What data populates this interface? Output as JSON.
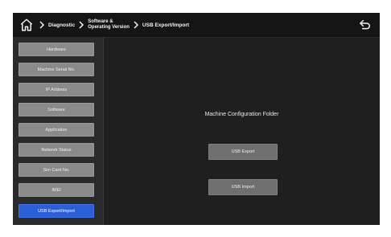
{
  "breadcrumb": {
    "home_icon": "home-icon",
    "items": [
      "Diagnostic",
      "Software &",
      "Operating Version",
      "USB Export/Import"
    ],
    "back_icon": "back-arrow-icon"
  },
  "sidebar": {
    "items": [
      {
        "label": "Hardware"
      },
      {
        "label": "Machine Serial No."
      },
      {
        "label": "IP Address"
      },
      {
        "label": "Software"
      },
      {
        "label": "Application"
      },
      {
        "label": "Network Status"
      },
      {
        "label": "Sim Card No."
      },
      {
        "label": "IMEI"
      },
      {
        "label": "USB Export/Import",
        "active": true
      }
    ]
  },
  "main": {
    "title": "Machine Configuration Folder",
    "export_label": "USB Export",
    "import_label": "USB Import"
  },
  "colors": {
    "background": "#1f1f1f",
    "sidebar": "#2a2a2a",
    "button": "#8a8a8a",
    "active": "#2c5fd6",
    "action_button": "#6f6f6f"
  }
}
